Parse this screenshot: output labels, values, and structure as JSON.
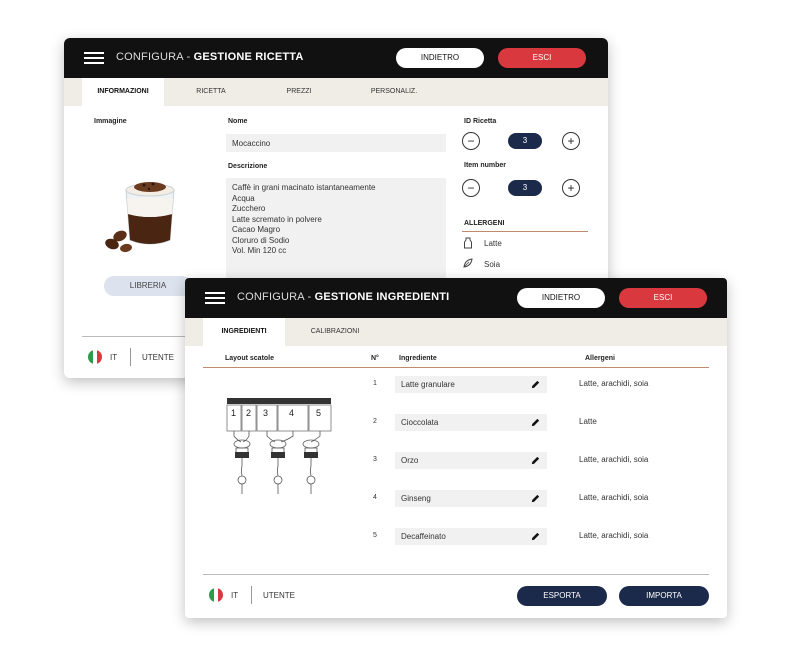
{
  "recipe_window": {
    "title_prefix": "CONFIGURA",
    "title_sep": " - ",
    "title_main": "GESTIONE RICETTA",
    "back_label": "INDIETRO",
    "exit_label": "ESCI",
    "tabs": [
      {
        "label": "INFORMAZIONI",
        "active": true
      },
      {
        "label": "RICETTA",
        "active": false
      },
      {
        "label": "PREZZI",
        "active": false
      },
      {
        "label": "PERSONALIZ.",
        "active": false
      }
    ],
    "image_label": "Immagine",
    "name_label": "Nome",
    "name_value": "Mocaccino",
    "description_label": "Descrizione",
    "description_lines": [
      "Caffè in grani macinato istantaneamente",
      "Acqua",
      "Zucchero",
      "Latte scremato in polvere",
      "Cacao Magro",
      "Cloruro di Sodio",
      "Vol. Min 120 cc"
    ],
    "id_label": "ID Ricetta",
    "id_value": "3",
    "item_label": "Item number",
    "item_value": "3",
    "allergens_label": "ALLERGENI",
    "allergens": [
      {
        "name": "Latte",
        "icon": "milk-icon"
      },
      {
        "name": "Soia",
        "icon": "soy-icon"
      }
    ],
    "library_label": "LIBRERIA",
    "lang": "IT",
    "user_label": "UTENTE"
  },
  "ingredients_window": {
    "title_prefix": "CONFIGURA",
    "title_sep": " - ",
    "title_main": "GESTIONE INGREDIENTI",
    "back_label": "INDIETRO",
    "exit_label": "ESCI",
    "tabs": [
      {
        "label": "INGREDIENTI",
        "active": true
      },
      {
        "label": "CALIBRAZIONI",
        "active": false
      }
    ],
    "columns": {
      "layout": "Layout scatole",
      "number": "N°",
      "ingredient": "Ingrediente",
      "allergens": "Allergeni"
    },
    "canister_numbers": [
      "1",
      "2",
      "3",
      "4",
      "5"
    ],
    "rows": [
      {
        "n": "1",
        "ingredient": "Latte granulare",
        "allergens": "Latte, arachidi, soia"
      },
      {
        "n": "2",
        "ingredient": "Cioccolata",
        "allergens": "Latte"
      },
      {
        "n": "3",
        "ingredient": "Orzo",
        "allergens": "Latte, arachidi, soia"
      },
      {
        "n": "4",
        "ingredient": "Ginseng",
        "allergens": "Latte, arachidi, soia"
      },
      {
        "n": "5",
        "ingredient": "Decaffeinato",
        "allergens": "Latte, arachidi, soia"
      }
    ],
    "lang": "IT",
    "user_label": "UTENTE",
    "export_label": "ESPORTA",
    "import_label": "IMPORTA"
  },
  "colors": {
    "topbar": "#111111",
    "exit_red": "#d9393e",
    "navy": "#1b2a4a",
    "tabbar": "#f0ede6",
    "field_bg": "#f1f1f1",
    "accent_line": "#c08a70"
  }
}
